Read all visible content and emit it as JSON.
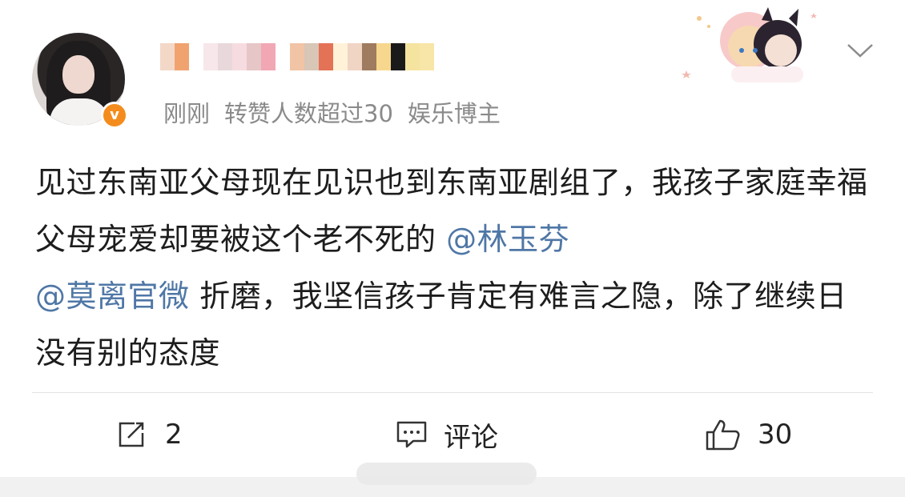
{
  "post": {
    "meta": {
      "time": "刚刚",
      "repost_note": "转赞人数超过30",
      "role": "娱乐博主"
    },
    "verify_badge": "v",
    "content_1": "见过东南亚父母现在见识也到东南亚剧组了，我孩子家庭幸福父母宠爱却要被这个老不死的",
    "mention_1": "@林玉芬",
    "mention_2": "@莫离官微",
    "content_2": " 折磨，我坚信孩子肯定有难言之隐，除了继续日没有别的态度"
  },
  "actions": {
    "repost_count": "2",
    "comment_label": "评论",
    "like_count": "30"
  },
  "colors": {
    "mention": "#4f77a6",
    "verify": "#f48c1d",
    "meta_gray": "#8a8a8a"
  },
  "icons": [
    "repost-icon",
    "comment-icon",
    "like-icon",
    "chevron-down-icon"
  ]
}
